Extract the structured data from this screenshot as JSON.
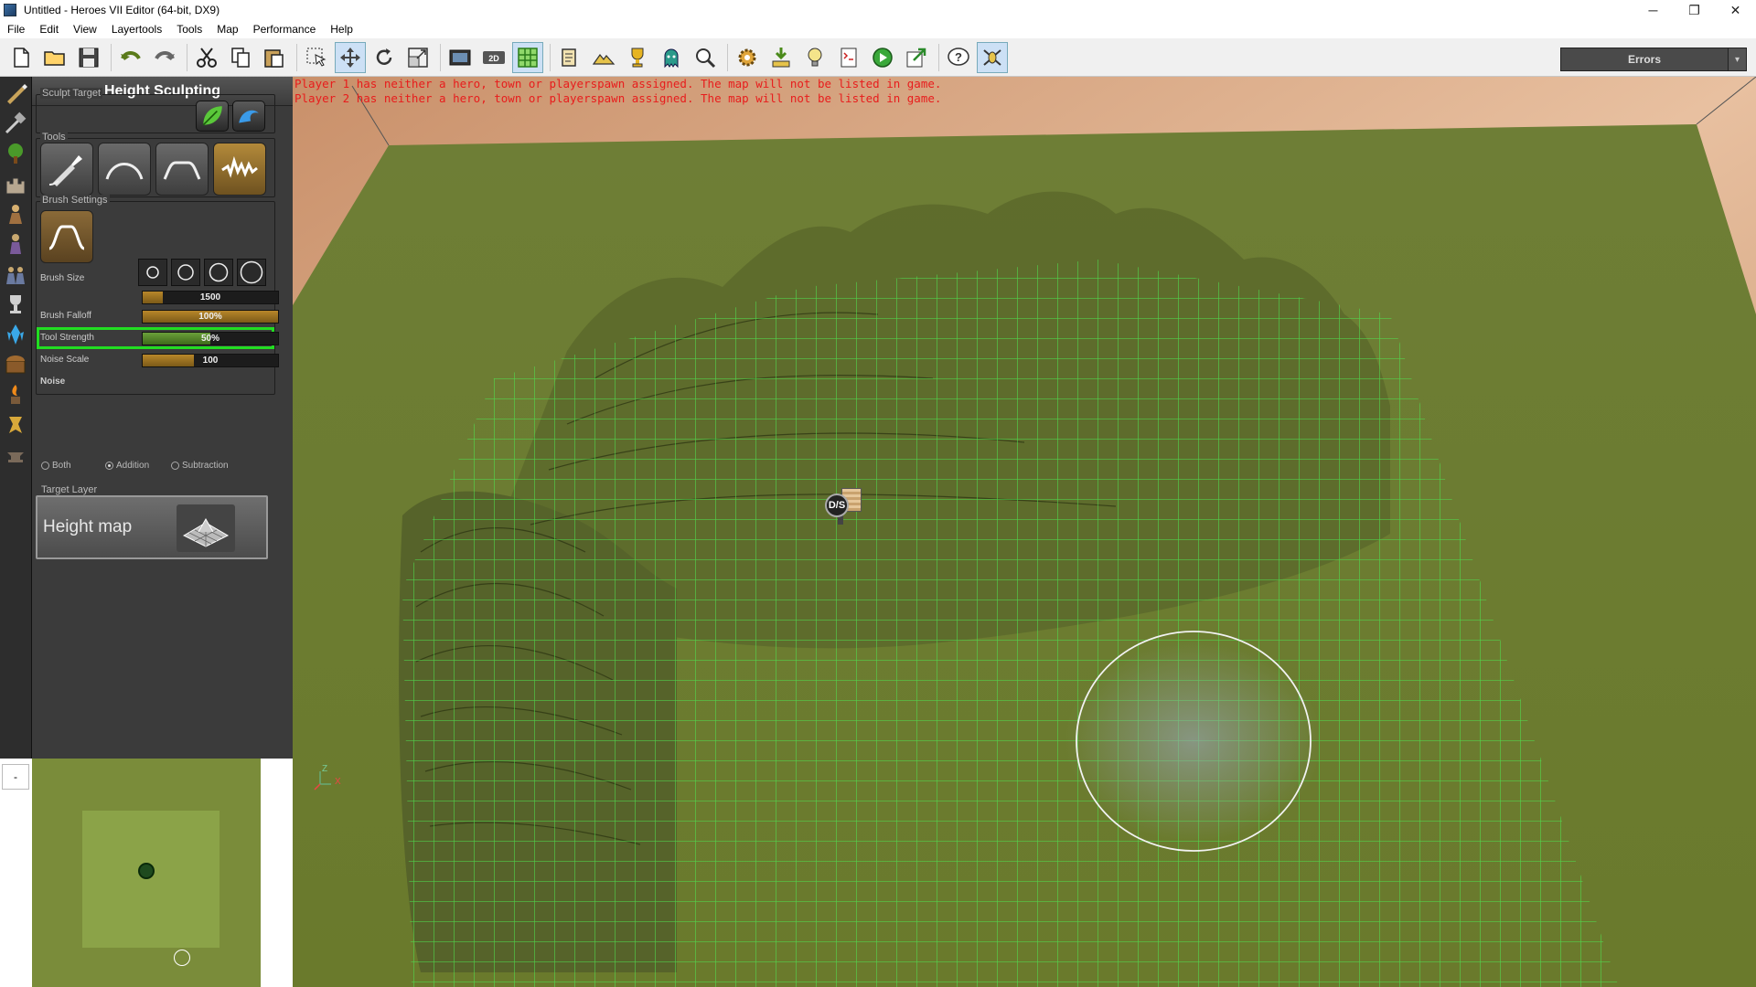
{
  "window": {
    "title": "Untitled - Heroes VII Editor (64-bit, DX9)",
    "minimize": "─",
    "restore": "❐",
    "close": "✕"
  },
  "menu": [
    "File",
    "Edit",
    "View",
    "Layertools",
    "Tools",
    "Map",
    "Performance",
    "Help"
  ],
  "toolbar": {
    "icons": [
      "new-file-icon",
      "open-folder-icon",
      "save-icon",
      "undo-icon",
      "redo-icon",
      "cut-icon",
      "copy-icon",
      "paste-icon",
      "select-icon",
      "move-icon",
      "rotate-icon",
      "scale-icon",
      "screenshot-icon",
      "2d-view-icon",
      "grid-icon",
      "map-info-icon",
      "terrain-icon",
      "goal-icon",
      "ghost-icon",
      "search-icon",
      "settings-gear-icon",
      "drop-icon",
      "light-bulb-icon",
      "script-icon",
      "play-icon",
      "export-icon",
      "help-icon",
      "debug-icon"
    ],
    "errors_label": "Errors",
    "errors_dropdown": "▾"
  },
  "panel": {
    "title": "Height Sculpting",
    "sculpt_target_label": "Sculpt Target",
    "tools_label": "Tools",
    "brush_settings_label": "Brush Settings",
    "brush_size_label": "Brush Size",
    "brush_size_value": "1500",
    "brush_size_fill": 0.15,
    "brush_falloff_label": "Brush Falloff",
    "brush_falloff_value": "100%",
    "brush_falloff_fill": 1.0,
    "tool_strength_label": "Tool Strength",
    "tool_strength_value": "50%",
    "tool_strength_fill": 0.5,
    "noise_scale_label": "Noise Scale",
    "noise_scale_value": "100",
    "noise_scale_fill": 0.38,
    "noise_label": "Noise",
    "noise_options": [
      "Both",
      "Addition",
      "Subtraction"
    ],
    "noise_selected": "Addition",
    "target_layer_label": "Target Layer",
    "target_layer_value": "Height map"
  },
  "viewport": {
    "messages": [
      "Player 1 has neither a hero, town or playerspawn assigned. The map will not be listed in game.",
      "Player 2 has neither a hero, town or playerspawn assigned. The map will not be listed in game."
    ],
    "marker_label": "D/S",
    "axis_z": "Z",
    "axis_x": "X"
  },
  "minimap": {
    "collapse_button": "-"
  },
  "colors": {
    "accent_orange": "#b8872a",
    "highlight_green": "#22dd22",
    "message_red": "#e81c1c",
    "grid_green": "#4fe04f"
  }
}
